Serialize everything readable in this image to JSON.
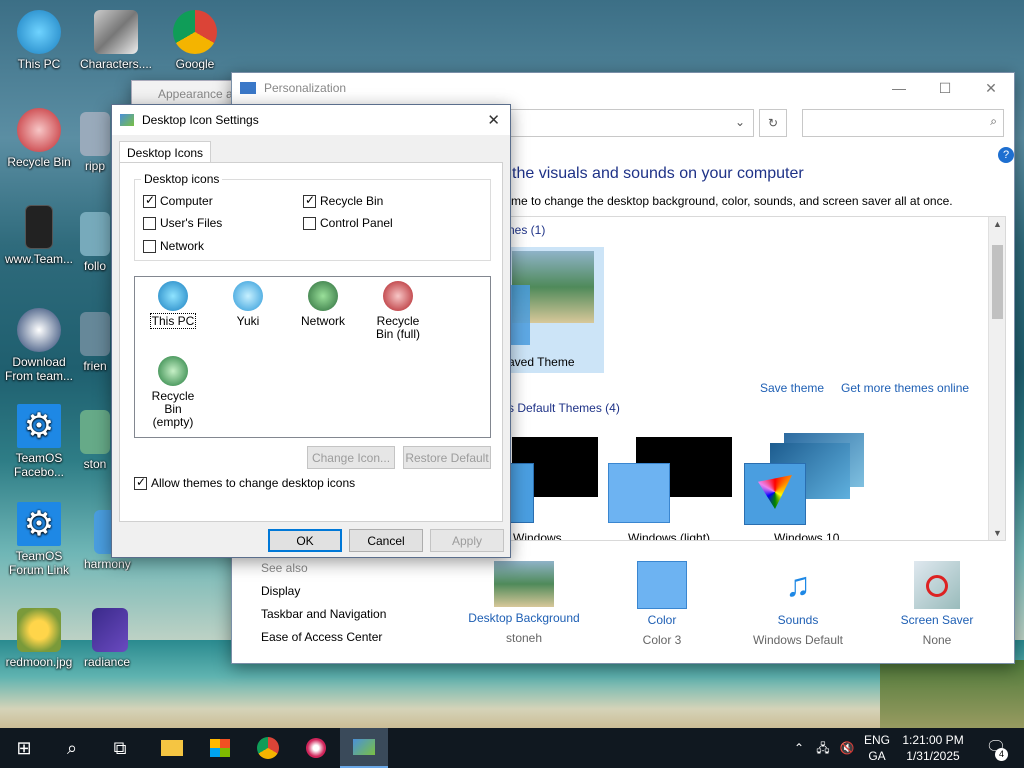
{
  "desktop": {
    "icons": [
      {
        "label": "This PC"
      },
      {
        "label": "Characters...."
      },
      {
        "label": "Google Chrome"
      },
      {
        "label": "Recycle Bin"
      },
      {
        "label": "ripp"
      },
      {
        "label": "www.Team..."
      },
      {
        "label": "follo"
      },
      {
        "label": "Download From team..."
      },
      {
        "label": "frien"
      },
      {
        "label": "TeamOS Facebo..."
      },
      {
        "label": "ston"
      },
      {
        "label": "TeamOS Forum Link"
      },
      {
        "label": "harmony"
      },
      {
        "label": "redmoon.jpg"
      },
      {
        "label": "radiance"
      }
    ]
  },
  "appearance_window": {
    "title": "Appearance a"
  },
  "personalization": {
    "title": "Personalization",
    "heading": "the visuals and sounds on your computer",
    "subtext": "me to change the desktop background, color, sounds, and screen saver all at once.",
    "my_themes_label": "nes (1)",
    "saved_theme_label": "aved Theme",
    "save_theme": "Save theme",
    "get_more_themes": "Get more themes online",
    "default_themes_label": "s Default Themes (4)",
    "default_themes": [
      "Windows",
      "Windows (light)",
      "Windows 10"
    ],
    "see_also": {
      "title": "See also",
      "items": [
        "Display",
        "Taskbar and Navigation",
        "Ease of Access Center"
      ]
    },
    "bottom": [
      {
        "label": "Desktop Background",
        "sub": "stoneh"
      },
      {
        "label": "Color",
        "sub": "Color 3"
      },
      {
        "label": "Sounds",
        "sub": "Windows Default"
      },
      {
        "label": "Screen Saver",
        "sub": "None"
      }
    ]
  },
  "dialog": {
    "title": "Desktop Icon Settings",
    "tab": "Desktop Icons",
    "group_title": "Desktop icons",
    "checkboxes": [
      {
        "label": "Computer",
        "checked": true
      },
      {
        "label": "Recycle Bin",
        "checked": true
      },
      {
        "label": "User's Files",
        "checked": false
      },
      {
        "label": "Control Panel",
        "checked": false
      },
      {
        "label": "Network",
        "checked": false
      }
    ],
    "icons": [
      {
        "label": "This PC"
      },
      {
        "label": "Yuki"
      },
      {
        "label": "Network"
      },
      {
        "label": "Recycle Bin (full)"
      },
      {
        "label": "Recycle Bin (empty)"
      }
    ],
    "change_icon": "Change Icon...",
    "restore_default": "Restore Default",
    "allow_themes": "Allow themes to change desktop icons",
    "allow_themes_checked": true,
    "ok": "OK",
    "cancel": "Cancel",
    "apply": "Apply"
  },
  "taskbar": {
    "lang_1": "ENG",
    "lang_2": "GA",
    "time": "1:21:00 PM",
    "date": "1/31/2025",
    "notification_count": "4"
  },
  "colors": {
    "link": "#1e5fb4",
    "heading": "#1e3287",
    "taskbar": "#101820",
    "accent": "#0078d7"
  }
}
